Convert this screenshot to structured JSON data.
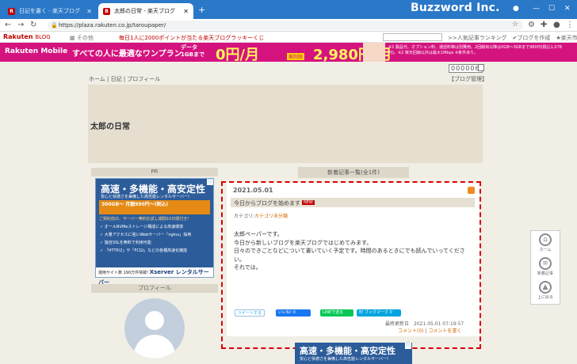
{
  "browser": {
    "tabs": [
      {
        "label": "日記を書く - 楽天ブログ",
        "favicon": "R",
        "active": false
      },
      {
        "label": "太郎の日常 - 楽天ブログ",
        "favicon": "B",
        "active": true
      }
    ],
    "brand": "Buzzword Inc.",
    "url": "https://plaza.rakuten.co.jp/taroupaper/"
  },
  "toolbar": {
    "logo": "Rakuten",
    "logo_sub": "BLOG",
    "other": "その他",
    "campaign": "毎日1人に2000ポイントが当たる楽天ブログラッキーくじ",
    "links": ">>人気記事ランキング　✔ブログを作成　★楽天市場"
  },
  "banner": {
    "brand": "Rakuten Mobile",
    "headline": "すべての人に最適なワンプラン",
    "data_label": "データ",
    "data_value": "1GBまで",
    "price_zero": "0円/月",
    "badge": "無制限",
    "price": "2,980円/月",
    "note": "※1 製品代、オプション料、通話料等は別費用。2回線目以降は0GB〜3GBまで980円(税込1,078円)。※2 楽天回線以外は最大1Mbps ※条件あり。"
  },
  "page": {
    "counter": "000006",
    "breadcrumb": "ホーム | 日記 | プロフィール",
    "manage": "【ブログ管理】",
    "blog_title": "太郎の日常"
  },
  "sidebar": {
    "pr_head": "PR",
    "ad": {
      "title": "高速・多機能・高安定性",
      "sub": "安心と快適さを兼備した高性能レンタルサーバー!",
      "offer": "300GB〜 月額990円〜(税込)",
      "trial": "ご契約前の、サーバー無料お試し期間10日間付き!",
      "features": [
        "オールNVMeストレージ構成による高速環境",
        "大量アクセスに強いWebサーバー「nginx」採用",
        "独自SSLを無料で利用可能",
        "「HTTP/2」や「FCGI」などの各種高速化機能"
      ],
      "footer_pre": "運用サイト数 190万件突破!",
      "footer_brand": "Xserver レンタルサーバー"
    },
    "profile_head": "プロフィール"
  },
  "main": {
    "list_head": "新着記事一覧(全1件)",
    "post": {
      "date": "2021.05.01",
      "title": "今日からブログを始めます",
      "new_badge": "NEW",
      "category_label": "カテゴリ:",
      "category": "カテゴリ未分類",
      "body": [
        "太郎ペーパーです。",
        "今日から新しいブログを楽天ブログではじめてみます。",
        "日々のできごとなどについて書いていく予定です。時間のあるときにでも読んでいってください。",
        "それでは。"
      ],
      "share": {
        "tweet": "ツイートする",
        "like": "いいね! 0",
        "line": "LINEで送る",
        "hatena": "B! ブックマーク 0"
      },
      "updated_label": "最終更新日",
      "updated": "2021.05.01 07:19:57",
      "comments": "コメント(0)",
      "write_comment": "コメントを書く"
    },
    "ad2": {
      "title": "高速・多機能・高安定性",
      "sub": "安心と快適さを兼備した高性能レンタルサーバー!"
    }
  },
  "sidenav": [
    {
      "label": "ホーム",
      "icon": "home-icon"
    },
    {
      "label": "新着記事",
      "icon": "list-icon"
    },
    {
      "label": "上に戻る",
      "icon": "up-icon"
    }
  ]
}
